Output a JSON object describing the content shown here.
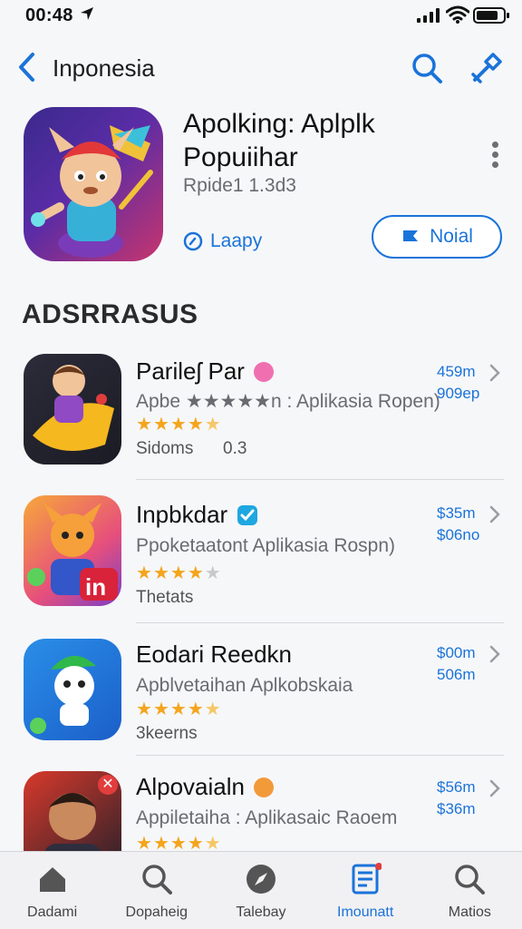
{
  "status_bar": {
    "time": "00:48"
  },
  "nav": {
    "title": "Inponesia"
  },
  "hero": {
    "title": "Apolking: Aplplk Popuiihar",
    "subtitle": "Rpide1 1.3d3",
    "link_label": "Laapy",
    "button_label": "Noial"
  },
  "section": {
    "title": "ADSRRASUS"
  },
  "apps": [
    {
      "name": "Parileʃ Par",
      "desc": "Apbe ★★★★★n : Aplikasia Ropen)",
      "rating": 4.5,
      "meta": "Sidoms",
      "meta2": "0.3",
      "price1": "459m",
      "price2": "909ep",
      "badge_color": "#f06fb0"
    },
    {
      "name": "Inpbkdar",
      "desc": "Ppoketaatont Aplikasia Rospn)",
      "rating": 4,
      "meta": "Thetats",
      "meta2": "",
      "price1": "$35m",
      "price2": "$06no",
      "badge_color": "#1ea7e0"
    },
    {
      "name": "Eodari Reedkn",
      "desc": "Apblvetaihan Aplkobskaia",
      "rating": 4.5,
      "meta": "3keerns",
      "meta2": "",
      "price1": "$00m",
      "price2": "506m",
      "badge_color": ""
    },
    {
      "name": "Alpovaialn",
      "desc": "Appiletaiha : Aplikasaic Raoem",
      "rating": 4.5,
      "meta": "",
      "meta2": "",
      "price1": "$56m",
      "price2": "$36m",
      "badge_color": "#f29a3a"
    }
  ],
  "tabs": [
    {
      "label": "Dadami",
      "icon": "home-icon"
    },
    {
      "label": "Dopaheig",
      "icon": "search-icon"
    },
    {
      "label": "Talebay",
      "icon": "compass-icon"
    },
    {
      "label": "Imounatt",
      "icon": "list-icon"
    },
    {
      "label": "Matios",
      "icon": "search-icon"
    }
  ],
  "colors": {
    "accent": "#1a73d9",
    "star": "#f4a51c",
    "background": "#f6f7f9"
  }
}
